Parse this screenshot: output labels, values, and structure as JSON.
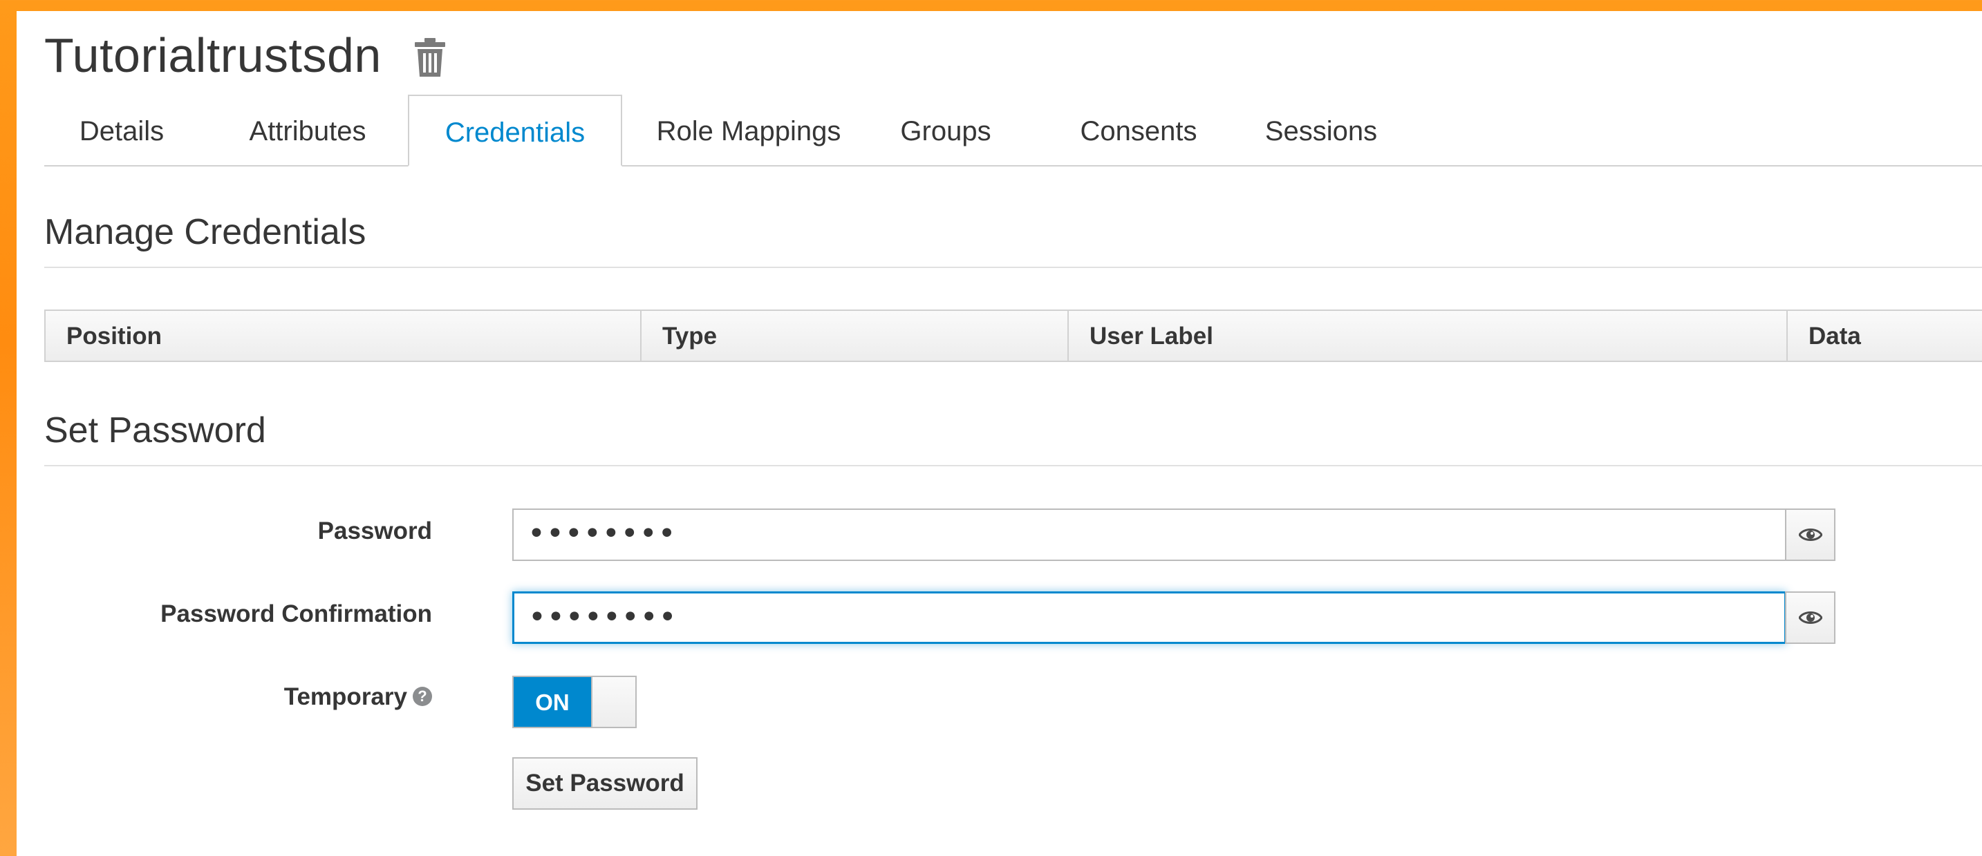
{
  "header": {
    "user_title": "Tutorialtrustsdn",
    "delete_icon": "trash-icon"
  },
  "tabs": [
    {
      "label": "Details",
      "active": false
    },
    {
      "label": "Attributes",
      "active": false
    },
    {
      "label": "Credentials",
      "active": true
    },
    {
      "label": "Role Mappings",
      "active": false
    },
    {
      "label": "Groups",
      "active": false
    },
    {
      "label": "Consents",
      "active": false
    },
    {
      "label": "Sessions",
      "active": false
    }
  ],
  "manage_credentials": {
    "title": "Manage Credentials",
    "columns": [
      "Position",
      "Type",
      "User Label",
      "Data"
    ]
  },
  "set_password": {
    "title": "Set Password",
    "password_label": "Password",
    "password_value": "••••••••",
    "confirm_label": "Password Confirmation",
    "confirm_value": "••••••••",
    "temporary_label": "Temporary",
    "temporary_help_icon": "question-circle-icon",
    "temporary_toggle": "ON",
    "reveal_icon": "eye-icon",
    "submit_label": "Set Password"
  },
  "colors": {
    "accent": "#0088ce",
    "text": "#363636",
    "background_frame": "#ff9a1a"
  }
}
